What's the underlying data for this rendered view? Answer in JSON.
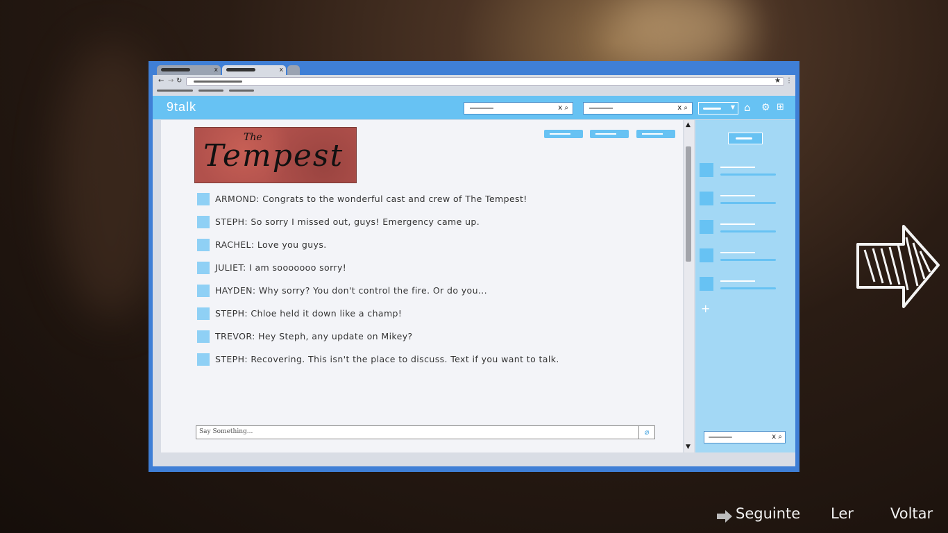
{
  "app": {
    "logo": "9talk"
  },
  "banner": {
    "small": "The",
    "big": "Tempest"
  },
  "messages": [
    {
      "text": "ARMOND: Congrats to the wonderful cast and crew of The Tempest!"
    },
    {
      "text": "STEPH: So sorry I missed out, guys! Emergency came up."
    },
    {
      "text": "RACHEL: Love you guys."
    },
    {
      "text": "JULIET: I am sooooooo sorry!"
    },
    {
      "text": "HAYDEN: Why sorry? You don't control the fire. Or do you..."
    },
    {
      "text": "STEPH: Chloe held it down like a champ!"
    },
    {
      "text": "TREVOR: Hey Steph, any update on Mikey?"
    },
    {
      "text": "STEPH: Recovering. This isn't the place to discuss. Text if you want to talk."
    }
  ],
  "input": {
    "placeholder": "Say Something..."
  },
  "glyphs": {
    "close": "x",
    "search": "⌕",
    "back": "←",
    "forward": "→",
    "reload": "↻",
    "star": "★",
    "more": "⋮",
    "plus": "+",
    "clip": "⌀",
    "up": "▲",
    "down": "▼",
    "home": "⌂",
    "gear": "⚙",
    "grid": "⊞",
    "caret": "▼"
  },
  "menu": {
    "next": "Seguinte",
    "read": "Ler",
    "back": "Voltar"
  },
  "colors": {
    "accent": "#67c2f3",
    "frame": "#3f7fd6",
    "sidebar": "#a3d8f5"
  }
}
